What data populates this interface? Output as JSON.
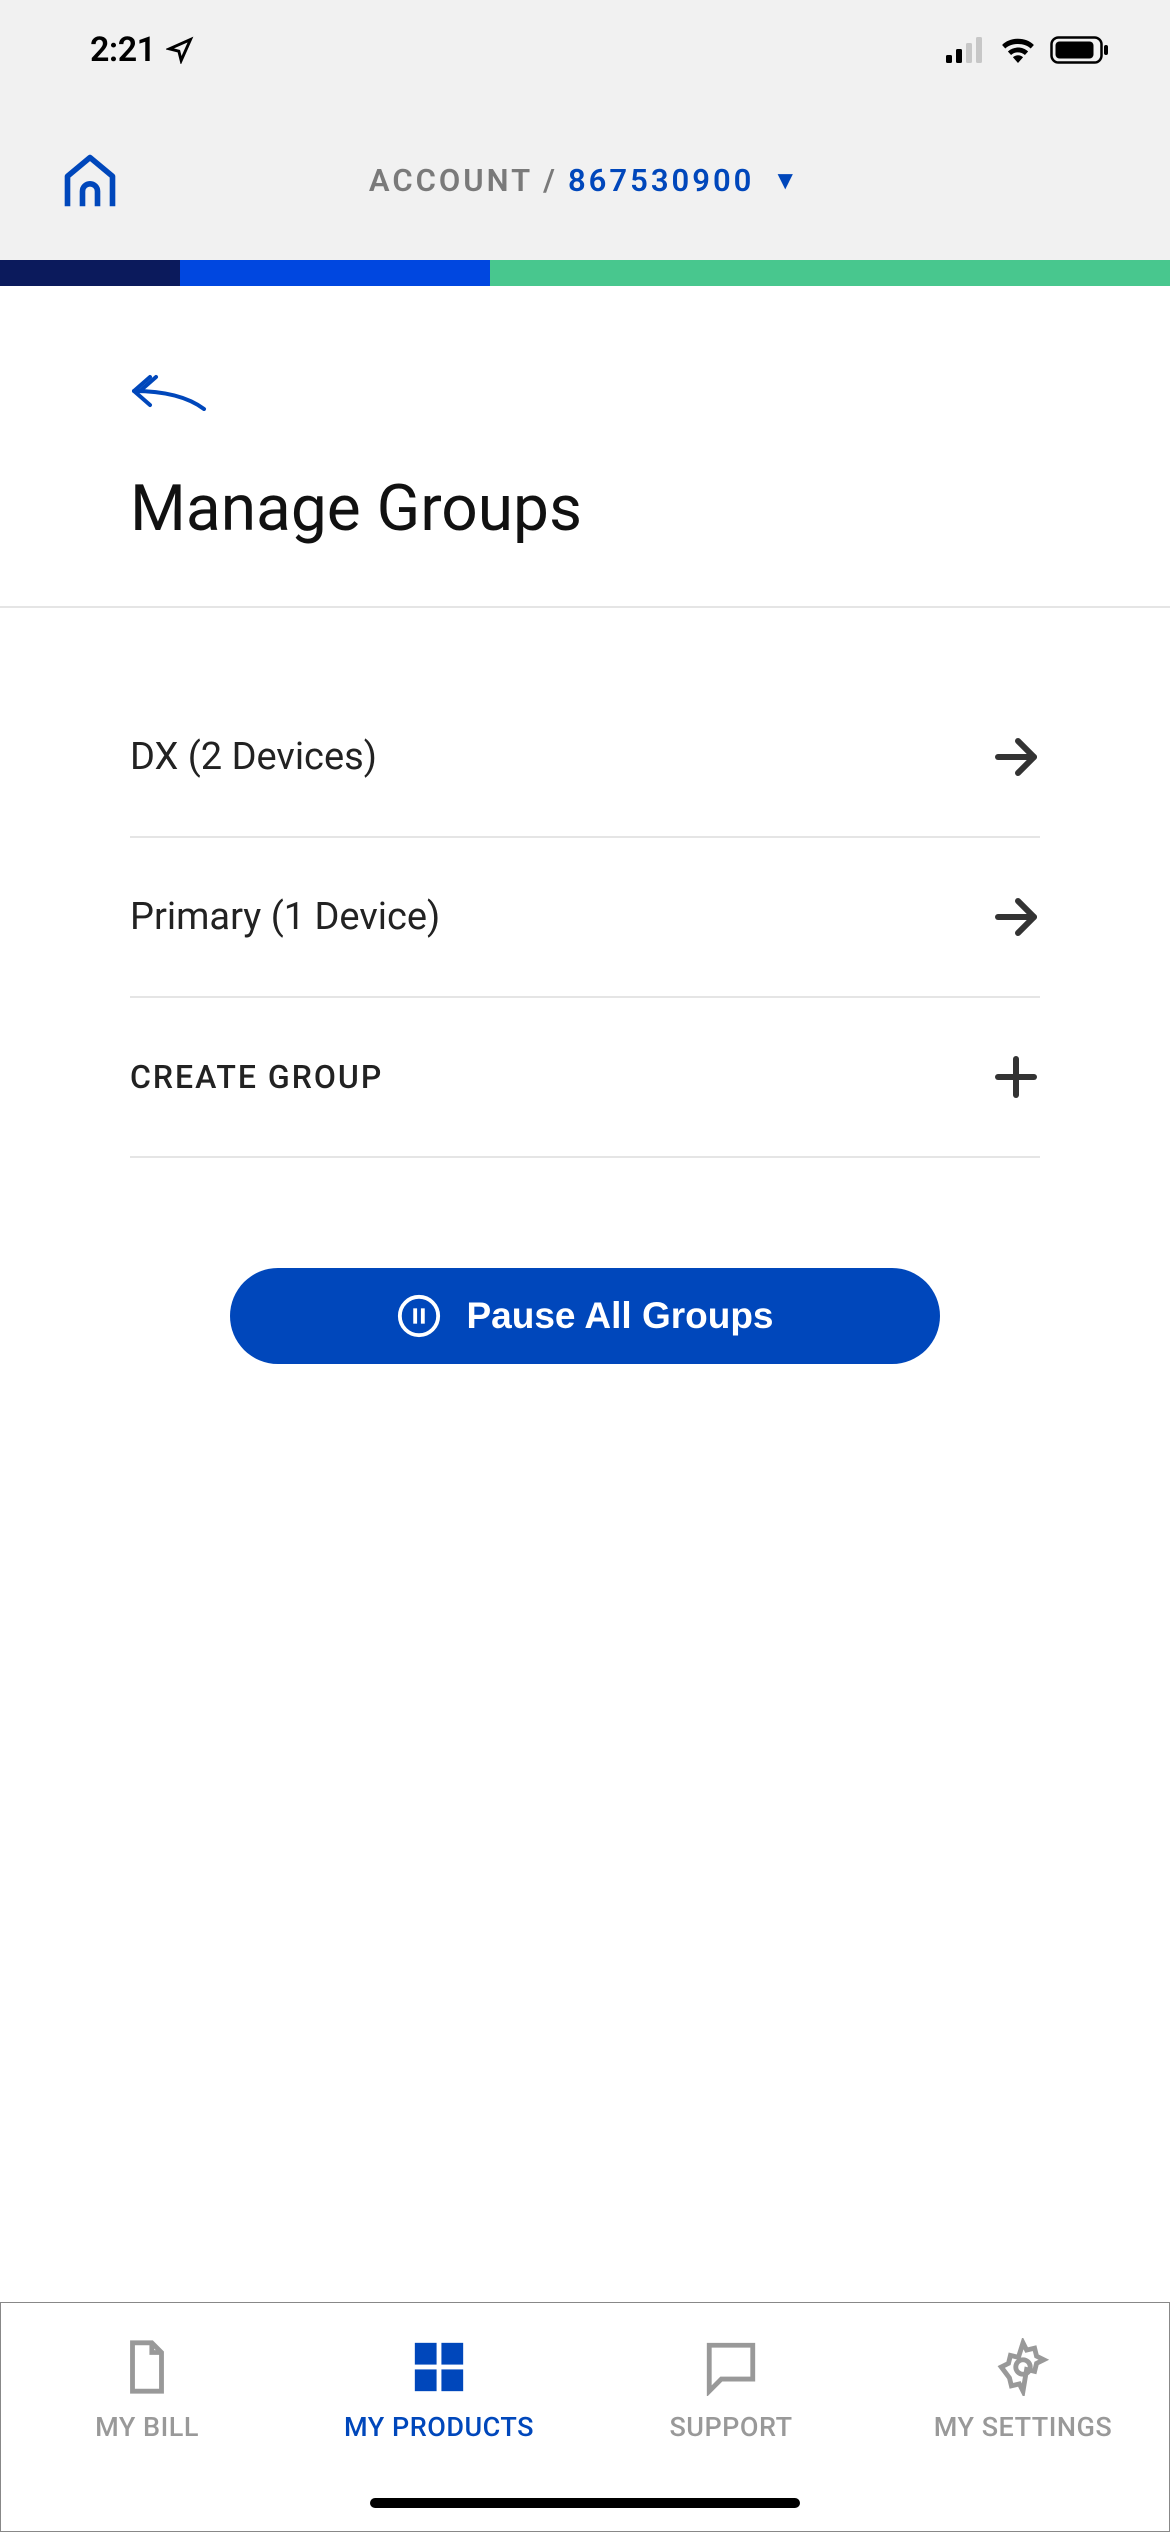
{
  "status": {
    "time": "2:21"
  },
  "header": {
    "account_label": "ACCOUNT",
    "separator": "/",
    "account_number": "867530900"
  },
  "page": {
    "title": "Manage Groups"
  },
  "groups": [
    {
      "label": "DX (2 Devices)"
    },
    {
      "label": "Primary (1 Device)"
    }
  ],
  "create_group_label": "CREATE GROUP",
  "pause_button_label": "Pause All Groups",
  "nav": {
    "bill": "MY BILL",
    "products": "MY PRODUCTS",
    "support": "SUPPORT",
    "settings": "MY SETTINGS"
  }
}
